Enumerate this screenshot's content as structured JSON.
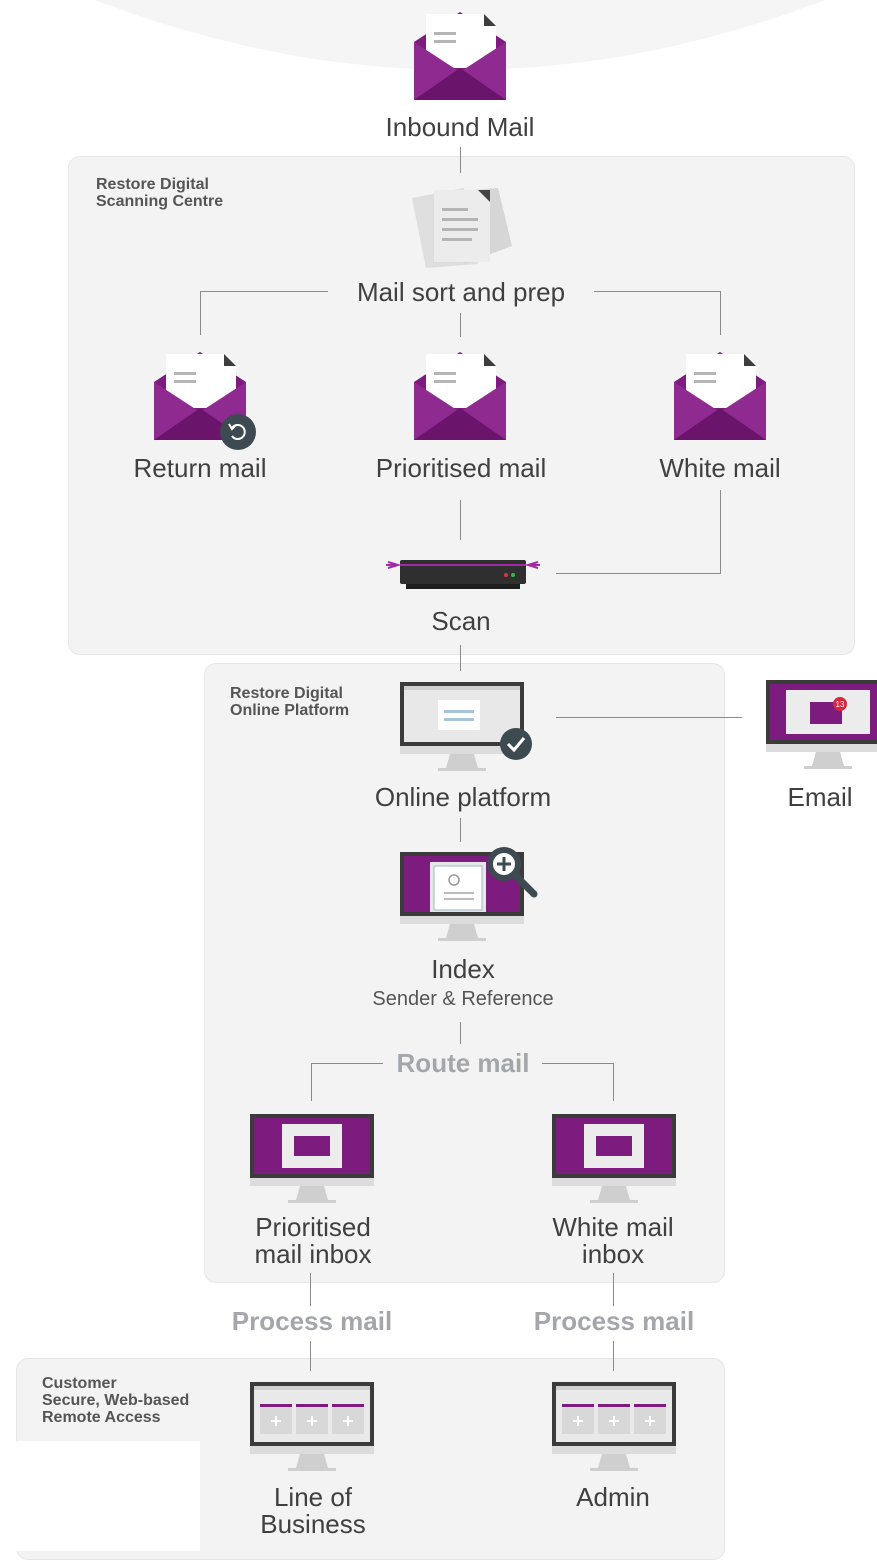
{
  "colors": {
    "purple": "#7d1b7e",
    "purple_dark": "#5e1160",
    "panel": "#f3f3f3",
    "line": "#8a8a8a",
    "action_text": "#a3a7ab",
    "badge": "#d7263d"
  },
  "panels": {
    "scanning_centre": "Restore Digital\nScanning Centre",
    "online_platform": "Restore Digital\nOnline Platform",
    "customer": "Customer\nSecure, Web-based\nRemote Access"
  },
  "nodes": {
    "inbound_mail": "Inbound Mail",
    "mail_sort": "Mail sort and prep",
    "return_mail": "Return mail",
    "prioritised_mail": "Prioritised mail",
    "white_mail": "White mail",
    "scan": "Scan",
    "online_platform": "Online platform",
    "email": "Email",
    "email_badge": "13",
    "index": "Index",
    "index_sub": "Sender & Reference",
    "route_mail": "Route mail",
    "prioritised_inbox": "Prioritised\nmail inbox",
    "white_inbox": "White mail\ninbox",
    "process_mail_left": "Process mail",
    "process_mail_right": "Process mail",
    "line_of_business": "Line of\nBusiness",
    "admin": "Admin"
  },
  "icons": {
    "inbound": "envelope-icon",
    "docs": "documents-icon",
    "return_badge": "return-arrow-icon",
    "scanner": "scanner-icon",
    "monitor": "monitor-icon",
    "check": "check-icon",
    "magnifier": "magnifier-icon"
  }
}
